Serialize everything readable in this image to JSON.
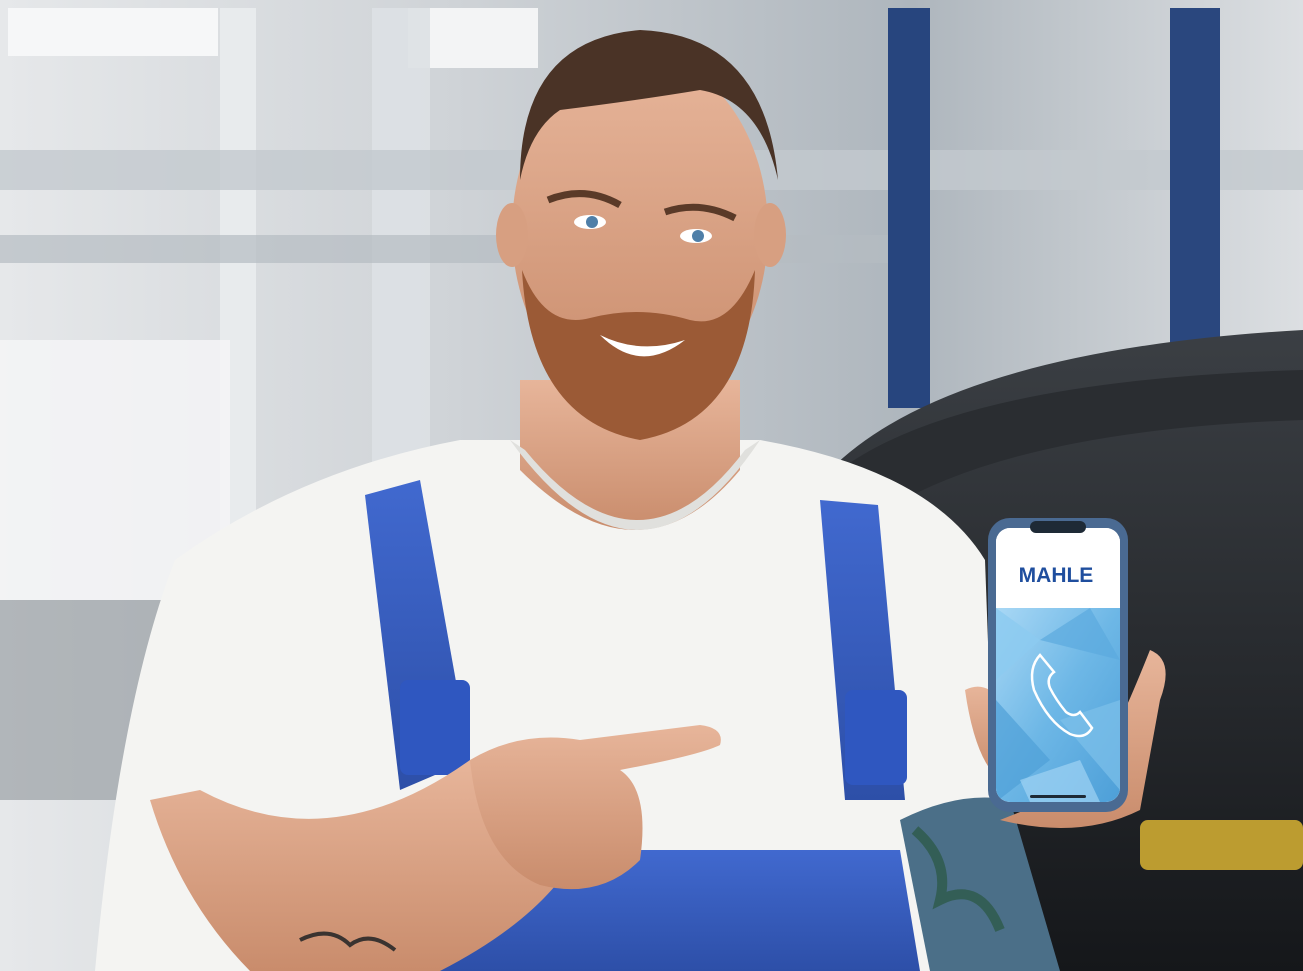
{
  "photo": {
    "subject_shirt_color": "#f4f4f2",
    "overall_color": "#3a5fc0",
    "background_tone": "#cfd3d6"
  },
  "phone": {
    "brand_logo_text": "MAHLE",
    "brand_color": "#1f4e9e",
    "screen_top_color": "#ffffff",
    "screen_pattern_color": "#79bde8",
    "icon": "phone-handset-icon"
  }
}
